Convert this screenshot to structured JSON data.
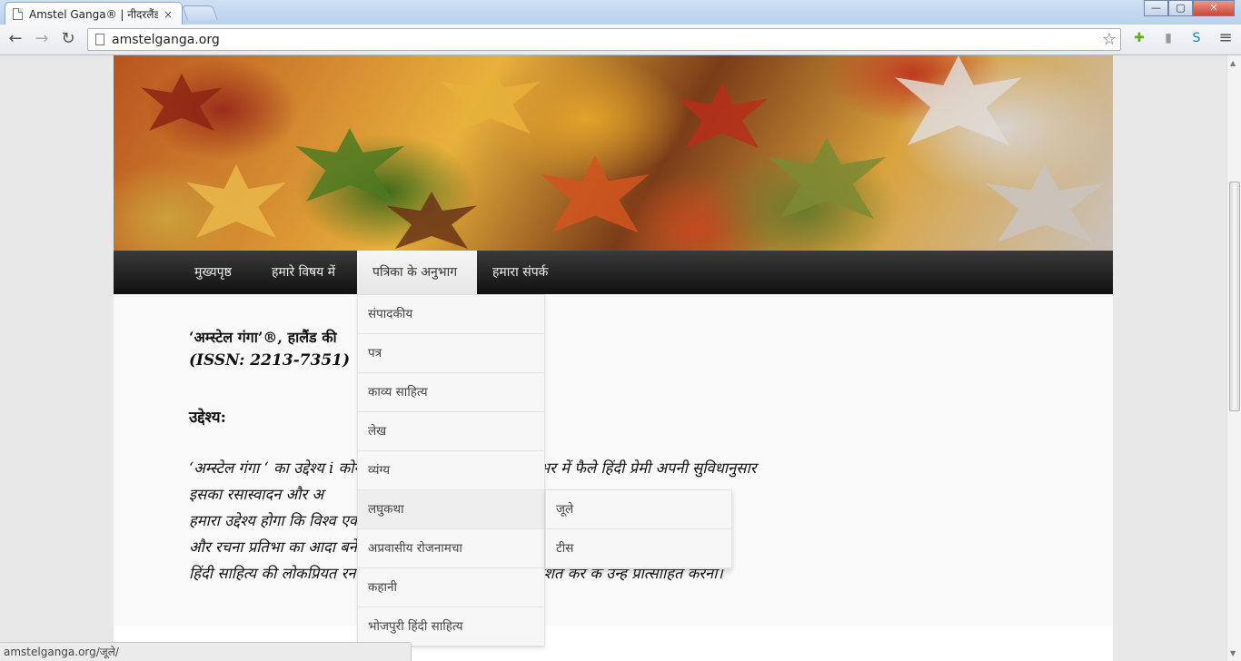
{
  "browser": {
    "tab_title": "Amstel Ganga® | नीदरलैंड से",
    "tab_close": "×",
    "url": "amstelganga.org",
    "status_url": "amstelganga.org/जूले/",
    "window_controls": {
      "minimize": "—",
      "maximize": "▢",
      "close": "✕"
    },
    "nav": {
      "back": "←",
      "forward": "→",
      "reload": "↻",
      "star": "☆",
      "menu": "≡"
    }
  },
  "menu": {
    "items": [
      {
        "label": "मुख्यपृष्ठ"
      },
      {
        "label": "हमारे विषय में"
      },
      {
        "label": "पत्रिका के अनुभाग"
      },
      {
        "label": "हमारा संपर्क"
      }
    ],
    "dropdown": [
      {
        "label": "संपादकीय"
      },
      {
        "label": "पत्र"
      },
      {
        "label": "काव्य साहित्य"
      },
      {
        "label": "लेख"
      },
      {
        "label": "व्यंग्य"
      },
      {
        "label": "लघुकथा"
      },
      {
        "label": "अप्रवासीय रोजनामचा"
      },
      {
        "label": "कहानी"
      },
      {
        "label": "भोजपुरी हिंदी साहित्य"
      }
    ],
    "submenu": [
      {
        "label": "जूले"
      },
      {
        "label": "टीस"
      }
    ]
  },
  "content": {
    "heading": "‘अम्स्टेल गंगा’®, हालैंड की",
    "issn": "(ISSN: 2213-7351)",
    "purpose_heading": "उद्देश्य:",
    "lines": [
      "‘अम्स्टेल गंगा ‘ का उद्देश्य i                                              कोने में सुलभ कराना है जिससे विश्व भर में फैले हिंदी प्रेमी अपनी सुविधानुसार",
      "इसका रसास्वादन और अ",
      "हमारा उद्देश्य होगा कि विश्व                                                                           एक मंच पर लाया जा सके जहाँ वे अपने अनुभवों",
      "और रचना प्रतिभा का आदा                                                                                 बनें।",
      "हिंदी साहित्य की लोकप्रियत                                              रना तथा नए लेखकों की रचनाएँ प्रकाशित कर के उन्हें प्रोत्साहित करना।"
    ]
  },
  "colors": {
    "menubar": "#1b1b1b",
    "accent_active": "#ececec"
  }
}
